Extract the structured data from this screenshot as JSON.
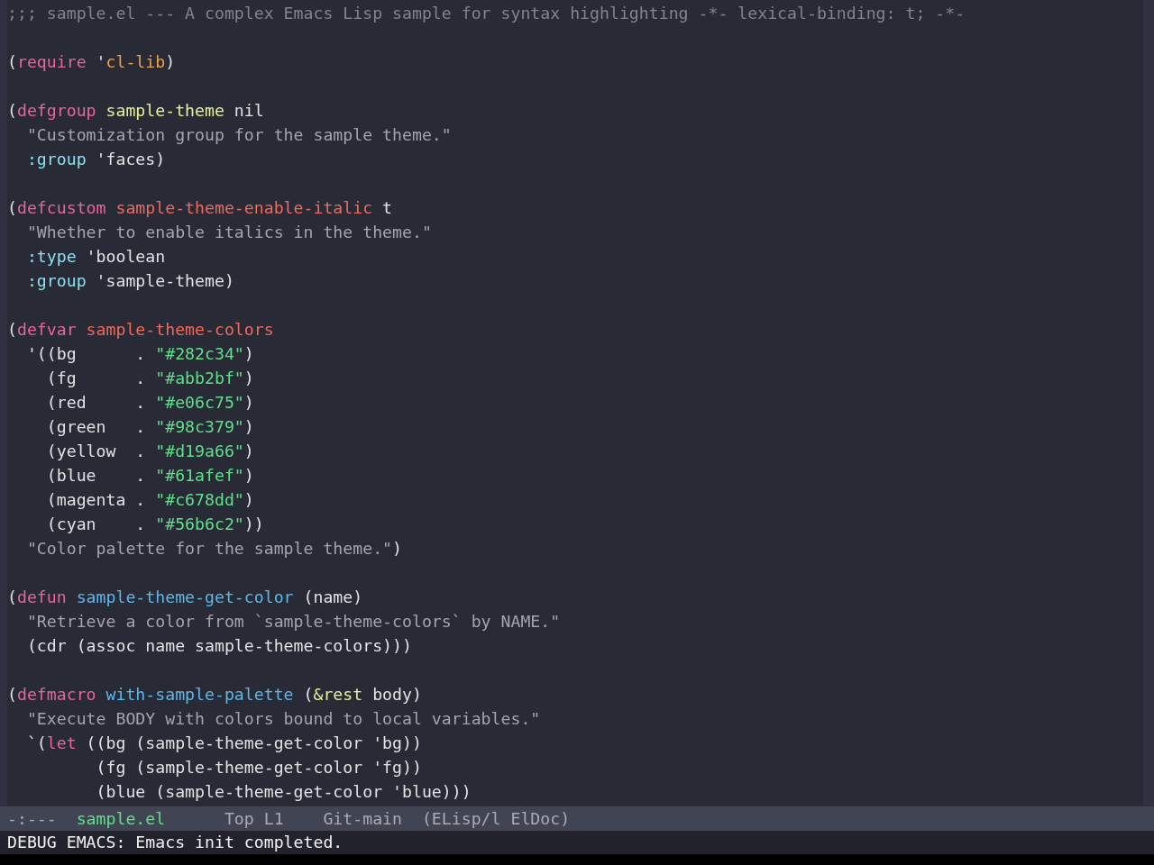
{
  "editor": {
    "forms": [
      {
        "lines": [
          {
            "tokens": [
              {
                "kind": "comment",
                "text": ";;; sample.el --- A complex Emacs Lisp sample for syntax highlighting -*- lexical-binding: t; -*-"
              }
            ]
          }
        ]
      },
      {
        "lines": [
          {
            "tokens": [
              {
                "kind": "plain",
                "text": "("
              },
              {
                "kind": "keyword",
                "text": "require"
              },
              {
                "kind": "plain",
                "text": " '"
              },
              {
                "kind": "quoted",
                "text": "cl-lib"
              },
              {
                "kind": "plain",
                "text": ")"
              }
            ]
          }
        ]
      },
      {
        "lines": [
          {
            "tokens": [
              {
                "kind": "plain",
                "text": "("
              },
              {
                "kind": "keyword",
                "text": "defgroup "
              },
              {
                "kind": "type",
                "text": "sample-theme"
              },
              {
                "kind": "plain",
                "text": " nil"
              }
            ]
          },
          {
            "tokens": [
              {
                "kind": "doc",
                "text": "  \"Customization group for the sample theme.\""
              }
            ]
          },
          {
            "tokens": [
              {
                "kind": "builtin",
                "text": "  :group"
              },
              {
                "kind": "plain",
                "text": " 'faces)"
              }
            ]
          }
        ]
      },
      {
        "lines": [
          {
            "tokens": [
              {
                "kind": "plain",
                "text": "("
              },
              {
                "kind": "keyword",
                "text": "defcustom "
              },
              {
                "kind": "variable",
                "text": "sample-theme-enable-italic"
              },
              {
                "kind": "plain",
                "text": " t"
              }
            ]
          },
          {
            "tokens": [
              {
                "kind": "doc",
                "text": "  \"Whether to enable italics in the theme.\""
              }
            ]
          },
          {
            "tokens": [
              {
                "kind": "builtin",
                "text": "  :type"
              },
              {
                "kind": "plain",
                "text": " 'boolean"
              }
            ]
          },
          {
            "tokens": [
              {
                "kind": "builtin",
                "text": "  :group"
              },
              {
                "kind": "plain",
                "text": " 'sample-theme)"
              }
            ]
          }
        ]
      },
      {
        "lines": [
          {
            "tokens": [
              {
                "kind": "plain",
                "text": "("
              },
              {
                "kind": "keyword",
                "text": "defvar "
              },
              {
                "kind": "variable",
                "text": "sample-theme-colors"
              }
            ]
          },
          {
            "tokens": [
              {
                "kind": "plain",
                "text": "  '((bg      . "
              },
              {
                "kind": "string",
                "text": "\"#282c34\""
              },
              {
                "kind": "plain",
                "text": ")"
              }
            ]
          },
          {
            "tokens": [
              {
                "kind": "plain",
                "text": "    (fg      . "
              },
              {
                "kind": "string",
                "text": "\"#abb2bf\""
              },
              {
                "kind": "plain",
                "text": ")"
              }
            ]
          },
          {
            "tokens": [
              {
                "kind": "plain",
                "text": "    (red     . "
              },
              {
                "kind": "string",
                "text": "\"#e06c75\""
              },
              {
                "kind": "plain",
                "text": ")"
              }
            ]
          },
          {
            "tokens": [
              {
                "kind": "plain",
                "text": "    (green   . "
              },
              {
                "kind": "string",
                "text": "\"#98c379\""
              },
              {
                "kind": "plain",
                "text": ")"
              }
            ]
          },
          {
            "tokens": [
              {
                "kind": "plain",
                "text": "    (yellow  . "
              },
              {
                "kind": "string",
                "text": "\"#d19a66\""
              },
              {
                "kind": "plain",
                "text": ")"
              }
            ]
          },
          {
            "tokens": [
              {
                "kind": "plain",
                "text": "    (blue    . "
              },
              {
                "kind": "string",
                "text": "\"#61afef\""
              },
              {
                "kind": "plain",
                "text": ")"
              }
            ]
          },
          {
            "tokens": [
              {
                "kind": "plain",
                "text": "    (magenta . "
              },
              {
                "kind": "string",
                "text": "\"#c678dd\""
              },
              {
                "kind": "plain",
                "text": ")"
              }
            ]
          },
          {
            "tokens": [
              {
                "kind": "plain",
                "text": "    (cyan    . "
              },
              {
                "kind": "string",
                "text": "\"#56b6c2\""
              },
              {
                "kind": "plain",
                "text": "))"
              }
            ]
          },
          {
            "tokens": [
              {
                "kind": "doc",
                "text": "  \"Color palette for the sample theme.\""
              },
              {
                "kind": "plain",
                "text": ")"
              }
            ]
          }
        ]
      },
      {
        "lines": [
          {
            "tokens": [
              {
                "kind": "plain",
                "text": "("
              },
              {
                "kind": "keyword",
                "text": "defun "
              },
              {
                "kind": "function",
                "text": "sample-theme-get-color"
              },
              {
                "kind": "plain",
                "text": " (name)"
              }
            ]
          },
          {
            "tokens": [
              {
                "kind": "doc",
                "text": "  \"Retrieve a color from `sample-theme-colors` by NAME.\""
              }
            ]
          },
          {
            "tokens": [
              {
                "kind": "plain",
                "text": "  (cdr (assoc name sample-theme-colors)))"
              }
            ]
          }
        ]
      },
      {
        "lines": [
          {
            "tokens": [
              {
                "kind": "plain",
                "text": "("
              },
              {
                "kind": "keyword",
                "text": "defmacro "
              },
              {
                "kind": "function",
                "text": "with-sample-palette"
              },
              {
                "kind": "plain",
                "text": " ("
              },
              {
                "kind": "type",
                "text": "&rest"
              },
              {
                "kind": "plain",
                "text": " body)"
              }
            ]
          },
          {
            "tokens": [
              {
                "kind": "doc",
                "text": "  \"Execute BODY with colors bound to local variables.\""
              }
            ]
          },
          {
            "tokens": [
              {
                "kind": "plain",
                "text": "  `("
              },
              {
                "kind": "keyword",
                "text": "let"
              },
              {
                "kind": "plain",
                "text": " ((bg (sample-theme-get-color 'bg))"
              }
            ]
          },
          {
            "tokens": [
              {
                "kind": "plain",
                "text": "         (fg (sample-theme-get-color 'fg))"
              }
            ]
          },
          {
            "tokens": [
              {
                "kind": "plain",
                "text": "         (blue (sample-theme-get-color 'blue)))"
              }
            ]
          }
        ]
      }
    ]
  },
  "mode_line": {
    "segments": [
      {
        "kind": "status",
        "text": "-:---"
      },
      {
        "kind": "buffer",
        "text": "sample.el"
      },
      {
        "kind": "position",
        "text": "Top L1"
      },
      {
        "kind": "vc",
        "text": "Git-main"
      },
      {
        "kind": "modes",
        "text": "(ELisp/l ElDoc)"
      }
    ]
  },
  "echo_area": {
    "message": "DEBUG EMACS: Emacs init completed."
  }
}
